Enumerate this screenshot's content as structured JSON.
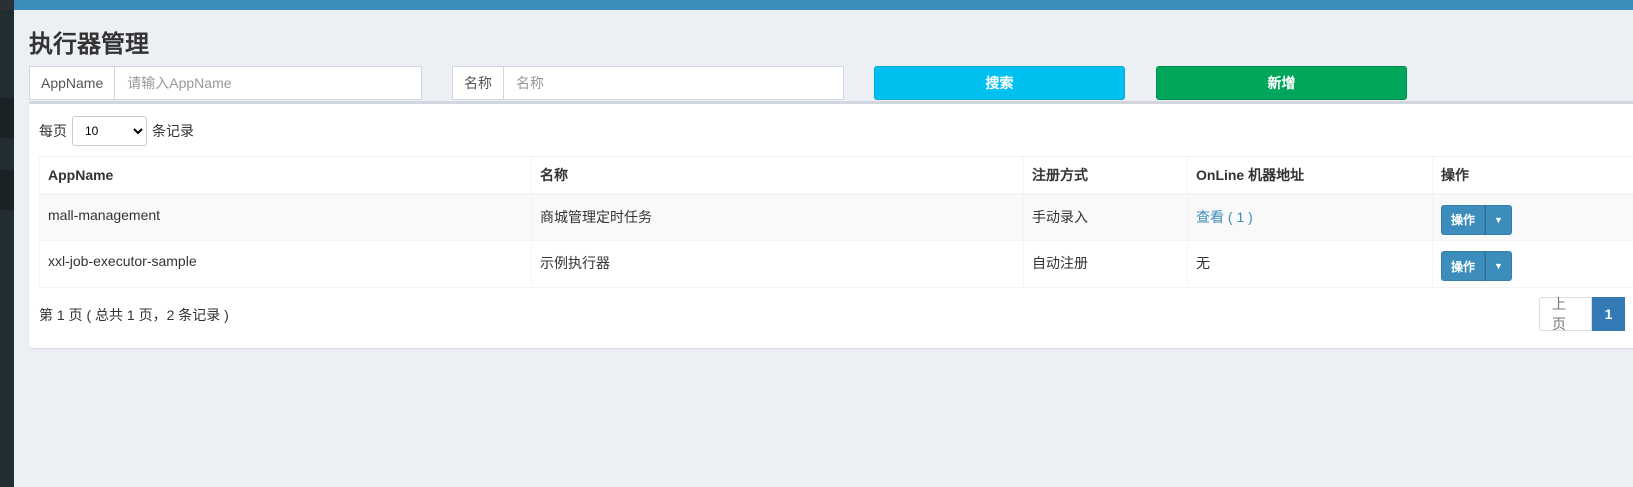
{
  "page": {
    "title": "执行器管理"
  },
  "filters": {
    "appname_label": "AppName",
    "appname_placeholder": "请输入AppName",
    "name_label": "名称",
    "name_placeholder": "名称",
    "search_label": "搜索",
    "add_label": "新增"
  },
  "length": {
    "prefix": "每页",
    "selected": "10",
    "suffix": "条记录"
  },
  "table": {
    "headers": [
      "AppName",
      "名称",
      "注册方式",
      "OnLine 机器地址",
      "操作"
    ],
    "rows": [
      {
        "appname": "mall-management",
        "name": "商城管理定时任务",
        "reg": "手动录入",
        "online": "查看 ( 1 )",
        "op": "操作"
      },
      {
        "appname": "xxl-job-executor-sample",
        "name": "示例执行器",
        "reg": "自动注册",
        "online": "无",
        "op": "操作"
      }
    ]
  },
  "pagination": {
    "info": "第 1 页 ( 总共 1 页，2 条记录 )",
    "prev": "上页",
    "current": "1"
  },
  "colors": {
    "header_bar": "#3c8dbc",
    "search_button": "#00c0ef",
    "add_button": "#00a65a",
    "primary": "#3c8dbc"
  },
  "icons": {
    "dropdown_caret": "caret-down-icon"
  }
}
